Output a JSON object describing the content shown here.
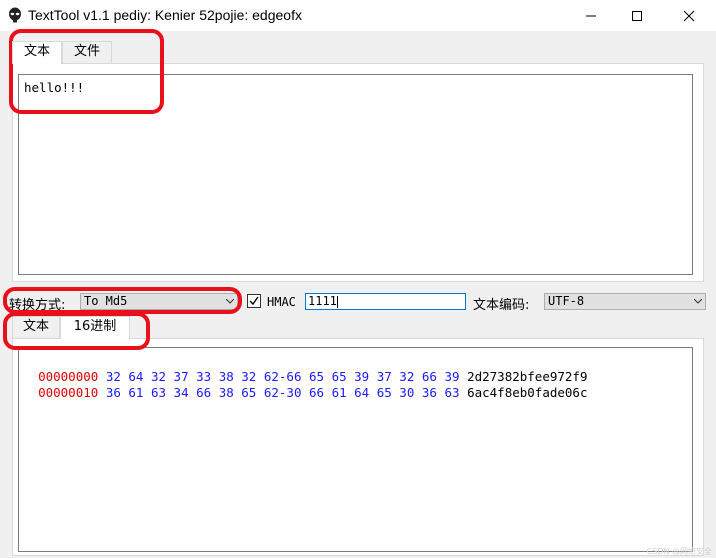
{
  "window": {
    "title": "TextTool v1.1 pediy: Kenier 52pojie: edgeofx",
    "app_icon": "alien-head-icon",
    "controls": {
      "minimize": "minimize-icon",
      "maximize": "maximize-icon",
      "close": "close-icon"
    }
  },
  "input_section": {
    "tabs": [
      {
        "label": "文本",
        "selected": true
      },
      {
        "label": "文件",
        "selected": false
      }
    ],
    "text": "hello!!!"
  },
  "options": {
    "convert_label": "转换方式:",
    "convert_value": "To Md5",
    "hmac_checked": true,
    "hmac_label": "HMAC",
    "hmac_key": "1111",
    "encoding_label": "文本编码:",
    "encoding_value": "UTF-8"
  },
  "output_section": {
    "tabs": [
      {
        "label": "文本",
        "selected": false
      },
      {
        "label": "16进制",
        "selected": true
      }
    ],
    "hex_rows": [
      {
        "offset": "00000000",
        "bytes": "32 64 32 37 33 38 32 62-66 65 65 39 37 32 66 39",
        "ascii": "2d27382bfee972f9"
      },
      {
        "offset": "00000010",
        "bytes": "36 61 63 34 66 38 65 62-30 66 61 64 65 30 36 63",
        "ascii": "6ac4f8eb0fade06c"
      }
    ]
  },
  "colors": {
    "annotation": "#e8101a",
    "hex_offset": "#e00000",
    "hex_bytes": "#1a1aff",
    "focus_border": "#0078d7"
  },
  "watermark": "CSDN @网络安全"
}
